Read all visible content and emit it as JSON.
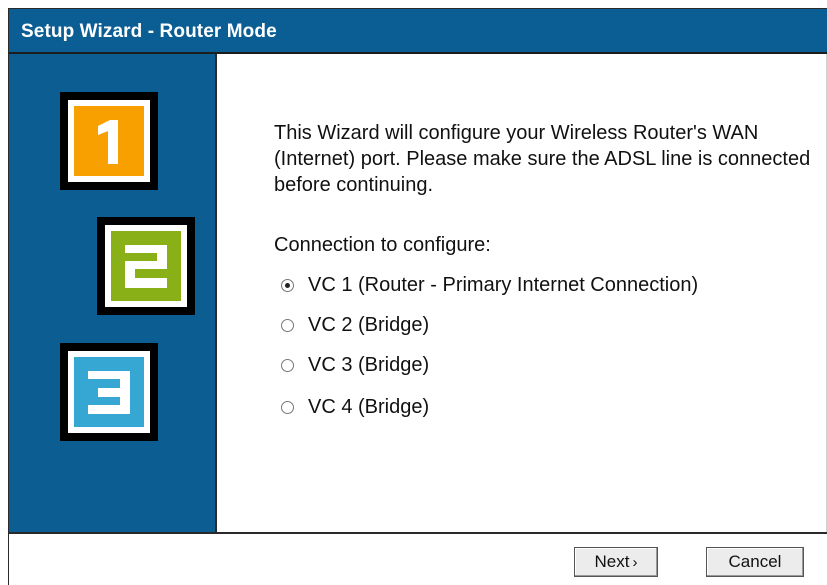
{
  "window": {
    "title": "Setup Wizard - Router Mode"
  },
  "steps": [
    {
      "label": "1",
      "color": "#f7a000"
    },
    {
      "label": "2",
      "color": "#8ab018"
    },
    {
      "label": "3",
      "color": "#35a7d2"
    }
  ],
  "content": {
    "intro": "This Wizard will configure your Wireless Router's WAN (Internet) port. Please make sure the ADSL line is connected before continuing.",
    "connection_label": "Connection to configure:",
    "options": [
      {
        "label": "VC 1 (Router - Primary Internet Connection)",
        "selected": true
      },
      {
        "label": "VC 2 (Bridge)",
        "selected": false
      },
      {
        "label": "VC 3 (Bridge)",
        "selected": false
      },
      {
        "label": "VC 4 (Bridge)",
        "selected": false
      }
    ]
  },
  "footer": {
    "next_label": "Next",
    "next_chevron": "›",
    "cancel_label": "Cancel"
  },
  "colors": {
    "title_bar": "#0a5e93",
    "sidebar": "#0b5d92"
  }
}
